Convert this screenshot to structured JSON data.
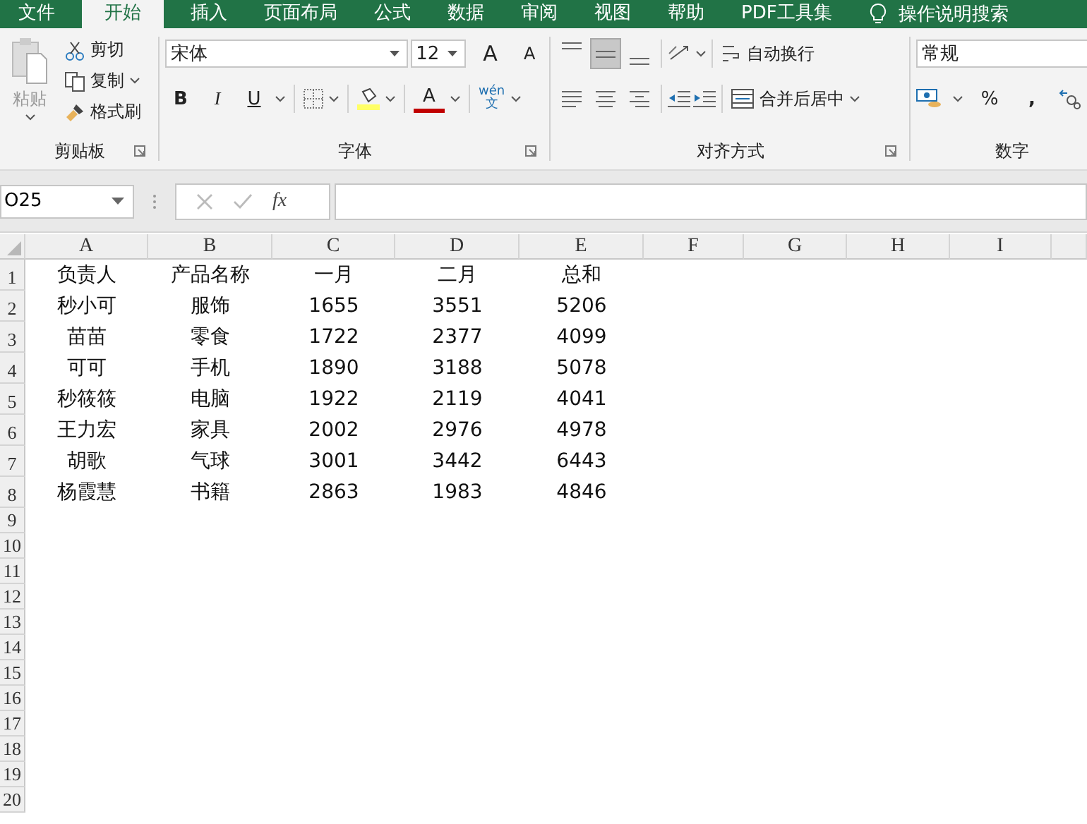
{
  "tabs": [
    {
      "label": "文件",
      "selected": false
    },
    {
      "label": "开始",
      "selected": true
    },
    {
      "label": "插入",
      "selected": false
    },
    {
      "label": "页面布局",
      "selected": false
    },
    {
      "label": "公式",
      "selected": false
    },
    {
      "label": "数据",
      "selected": false
    },
    {
      "label": "审阅",
      "selected": false
    },
    {
      "label": "视图",
      "selected": false
    },
    {
      "label": "帮助",
      "selected": false
    },
    {
      "label": "PDF工具集",
      "selected": false
    }
  ],
  "tell_me": "操作说明搜索",
  "clipboard": {
    "paste": "粘贴",
    "cut": "剪切",
    "copy": "复制",
    "format_painter": "格式刷",
    "label": "剪贴板"
  },
  "font": {
    "name": "宋体",
    "size": "12",
    "grow": "A",
    "shrink": "A",
    "bold": "B",
    "italic": "I",
    "underline": "U",
    "font_color": "A",
    "phonetic_top": "wén",
    "phonetic_bottom": "文",
    "label": "字体"
  },
  "alignment": {
    "vertical": [
      {
        "kind": "top",
        "selected": false
      },
      {
        "kind": "middle",
        "selected": true
      },
      {
        "kind": "bottom",
        "selected": false
      }
    ],
    "horizontal": [
      {
        "kind": "left",
        "selected": false
      },
      {
        "kind": "center",
        "selected": false
      },
      {
        "kind": "right",
        "selected": false
      }
    ],
    "wrap_text": "自动换行",
    "merge_center": "合并后居中",
    "label": "对齐方式"
  },
  "number": {
    "format": "常规",
    "percent": "%",
    "comma": ",",
    "label": "数字"
  },
  "name_box": "O25",
  "fx": "fx",
  "sheet": {
    "columns": [
      "A",
      "B",
      "C",
      "D",
      "E",
      "F",
      "G",
      "H",
      "I"
    ],
    "rows": [
      {
        "header": "1",
        "cells": [
          "负责人",
          "产品名称",
          "一月",
          "二月",
          "总和"
        ]
      },
      {
        "header": "2",
        "cells": [
          "秒小可",
          "服饰",
          "1655",
          "3551",
          "5206"
        ]
      },
      {
        "header": "3",
        "cells": [
          "苗苗",
          "零食",
          "1722",
          "2377",
          "4099"
        ]
      },
      {
        "header": "4",
        "cells": [
          "可可",
          "手机",
          "1890",
          "3188",
          "5078"
        ]
      },
      {
        "header": "5",
        "cells": [
          "秒筱筱",
          "电脑",
          "1922",
          "2119",
          "4041"
        ]
      },
      {
        "header": "6",
        "cells": [
          "王力宏",
          "家具",
          "2002",
          "2976",
          "4978"
        ]
      },
      {
        "header": "7",
        "cells": [
          "胡歌",
          "气球",
          "3001",
          "3442",
          "6443"
        ]
      },
      {
        "header": "8",
        "cells": [
          "杨霞慧",
          "书籍",
          "2863",
          "1983",
          "4846"
        ]
      },
      {
        "header": "9"
      },
      {
        "header": "10"
      },
      {
        "header": "11"
      },
      {
        "header": "12"
      },
      {
        "header": "13"
      },
      {
        "header": "14"
      },
      {
        "header": "15"
      },
      {
        "header": "16"
      },
      {
        "header": "17"
      },
      {
        "header": "18"
      },
      {
        "header": "19"
      },
      {
        "header": "20"
      }
    ]
  }
}
